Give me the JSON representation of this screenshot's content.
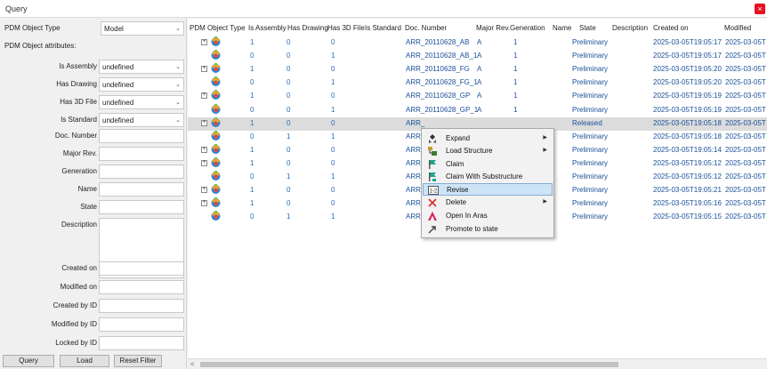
{
  "window": {
    "title": "Query",
    "close_glyph": "×"
  },
  "left_panel": {
    "object_type_label": "PDM Object Type",
    "object_type_value": "Model",
    "attributes_label": "PDM Object attributes:",
    "combo_fields": [
      {
        "label": "Is Assembly",
        "value": "undefined"
      },
      {
        "label": "Has Drawing",
        "value": "undefined"
      },
      {
        "label": "Has 3D File",
        "value": "undefined"
      },
      {
        "label": "Is Standard",
        "value": "undefined"
      }
    ],
    "text_fields": [
      "Doc. Number",
      "Major Rev.",
      "Generation",
      "Name",
      "State",
      "Description"
    ],
    "date_fields": [
      "Created on",
      "Modified on",
      "Created by ID",
      "Modified by ID",
      "Locked by ID"
    ],
    "buttons": {
      "query": "Query",
      "load": "Load",
      "reset": "Reset Filter"
    }
  },
  "grid": {
    "columns": [
      "PDM Object Type",
      "Is Assembly",
      "Has Drawing",
      "Has 3D File",
      "Is Standard",
      "Doc. Number",
      "Major Rev.",
      "Generation",
      "Name",
      "State",
      "Description",
      "Created on",
      "Modified"
    ],
    "rows": [
      {
        "expandable": true,
        "is_assembly": "1",
        "has_drawing": "0",
        "has_3d": "0",
        "doc": "ARR_20110628_AB",
        "rev": "A",
        "gen": "1",
        "state": "Preliminary",
        "created": "2025-03-05T19:05:17",
        "modified": "2025-03-05T"
      },
      {
        "expandable": false,
        "is_assembly": "0",
        "has_drawing": "0",
        "has_3d": "1",
        "doc": "ARR_20110628_AB_1",
        "rev": "A",
        "gen": "1",
        "state": "Preliminary",
        "created": "2025-03-05T19:05:17",
        "modified": "2025-03-05T"
      },
      {
        "expandable": true,
        "is_assembly": "1",
        "has_drawing": "0",
        "has_3d": "0",
        "doc": "ARR_20110628_FG",
        "rev": "A",
        "gen": "1",
        "state": "Preliminary",
        "created": "2025-03-05T19:05:20",
        "modified": "2025-03-05T"
      },
      {
        "expandable": false,
        "is_assembly": "0",
        "has_drawing": "0",
        "has_3d": "1",
        "doc": "ARR_20110628_FG_1",
        "rev": "A",
        "gen": "1",
        "state": "Preliminary",
        "created": "2025-03-05T19:05:20",
        "modified": "2025-03-05T"
      },
      {
        "expandable": true,
        "is_assembly": "1",
        "has_drawing": "0",
        "has_3d": "0",
        "doc": "ARR_20110628_GP",
        "rev": "A",
        "gen": "1",
        "state": "Preliminary",
        "created": "2025-03-05T19:05:19",
        "modified": "2025-03-05T"
      },
      {
        "expandable": false,
        "is_assembly": "0",
        "has_drawing": "0",
        "has_3d": "1",
        "doc": "ARR_20110628_GP_1",
        "rev": "A",
        "gen": "1",
        "state": "Preliminary",
        "created": "2025-03-05T19:05:19",
        "modified": "2025-03-05T"
      },
      {
        "expandable": true,
        "selected": true,
        "is_assembly": "1",
        "has_drawing": "0",
        "has_3d": "0",
        "doc": "ARR_",
        "rev": "",
        "gen": "",
        "state": "Released",
        "created": "2025-03-05T19:05:18",
        "modified": "2025-03-05T"
      },
      {
        "expandable": false,
        "is_assembly": "0",
        "has_drawing": "1",
        "has_3d": "1",
        "doc": "ARR_",
        "rev": "",
        "gen": "",
        "state": "Preliminary",
        "created": "2025-03-05T19:05:18",
        "modified": "2025-03-05T"
      },
      {
        "expandable": true,
        "is_assembly": "1",
        "has_drawing": "0",
        "has_3d": "0",
        "doc": "ARR_",
        "rev": "",
        "gen": "",
        "state": "Preliminary",
        "created": "2025-03-05T19:05:14",
        "modified": "2025-03-05T"
      },
      {
        "expandable": true,
        "is_assembly": "1",
        "has_drawing": "0",
        "has_3d": "0",
        "doc": "ARR_",
        "rev": "",
        "gen": "",
        "state": "Preliminary",
        "created": "2025-03-05T19:05:12",
        "modified": "2025-03-05T"
      },
      {
        "expandable": false,
        "is_assembly": "0",
        "has_drawing": "1",
        "has_3d": "1",
        "doc": "ARR_",
        "rev": "",
        "gen": "",
        "state": "Preliminary",
        "created": "2025-03-05T19:05:12",
        "modified": "2025-03-05T"
      },
      {
        "expandable": true,
        "is_assembly": "1",
        "has_drawing": "0",
        "has_3d": "0",
        "doc": "ARR_",
        "rev": "",
        "gen": "",
        "state": "Preliminary",
        "created": "2025-03-05T19:05:21",
        "modified": "2025-03-05T"
      },
      {
        "expandable": true,
        "is_assembly": "1",
        "has_drawing": "0",
        "has_3d": "0",
        "doc": "ARR_",
        "rev": "",
        "gen": "",
        "state": "Preliminary",
        "created": "2025-03-05T19:05:16",
        "modified": "2025-03-05T"
      },
      {
        "expandable": false,
        "is_assembly": "0",
        "has_drawing": "1",
        "has_3d": "1",
        "doc": "ARR_",
        "rev": "",
        "gen": "",
        "state": "Preliminary",
        "created": "2025-03-05T19:05:15",
        "modified": "2025-03-05T"
      }
    ]
  },
  "context_menu": {
    "items": [
      {
        "label": "Expand",
        "submenu": true,
        "icon": "expand-icon"
      },
      {
        "label": "Load Structure",
        "submenu": true,
        "icon": "load-structure-icon"
      },
      {
        "label": "Claim",
        "submenu": false,
        "icon": "claim-icon"
      },
      {
        "label": "Claim With Substructure",
        "submenu": false,
        "icon": "claim-substructure-icon"
      },
      {
        "label": "Revise",
        "submenu": false,
        "icon": "revise-icon",
        "highlighted": true
      },
      {
        "label": "Delete",
        "submenu": true,
        "icon": "delete-icon"
      },
      {
        "label": "Open In Aras",
        "submenu": false,
        "icon": "open-aras-icon"
      },
      {
        "label": "Promote to state",
        "submenu": false,
        "icon": "promote-icon"
      }
    ],
    "submenu_glyph": "▶",
    "revise_icon_text": "1-2"
  },
  "scrollbar": {
    "left_glyph": "<"
  },
  "icons": {
    "combo_arrow": "⌄",
    "expander_glyph": "+"
  }
}
